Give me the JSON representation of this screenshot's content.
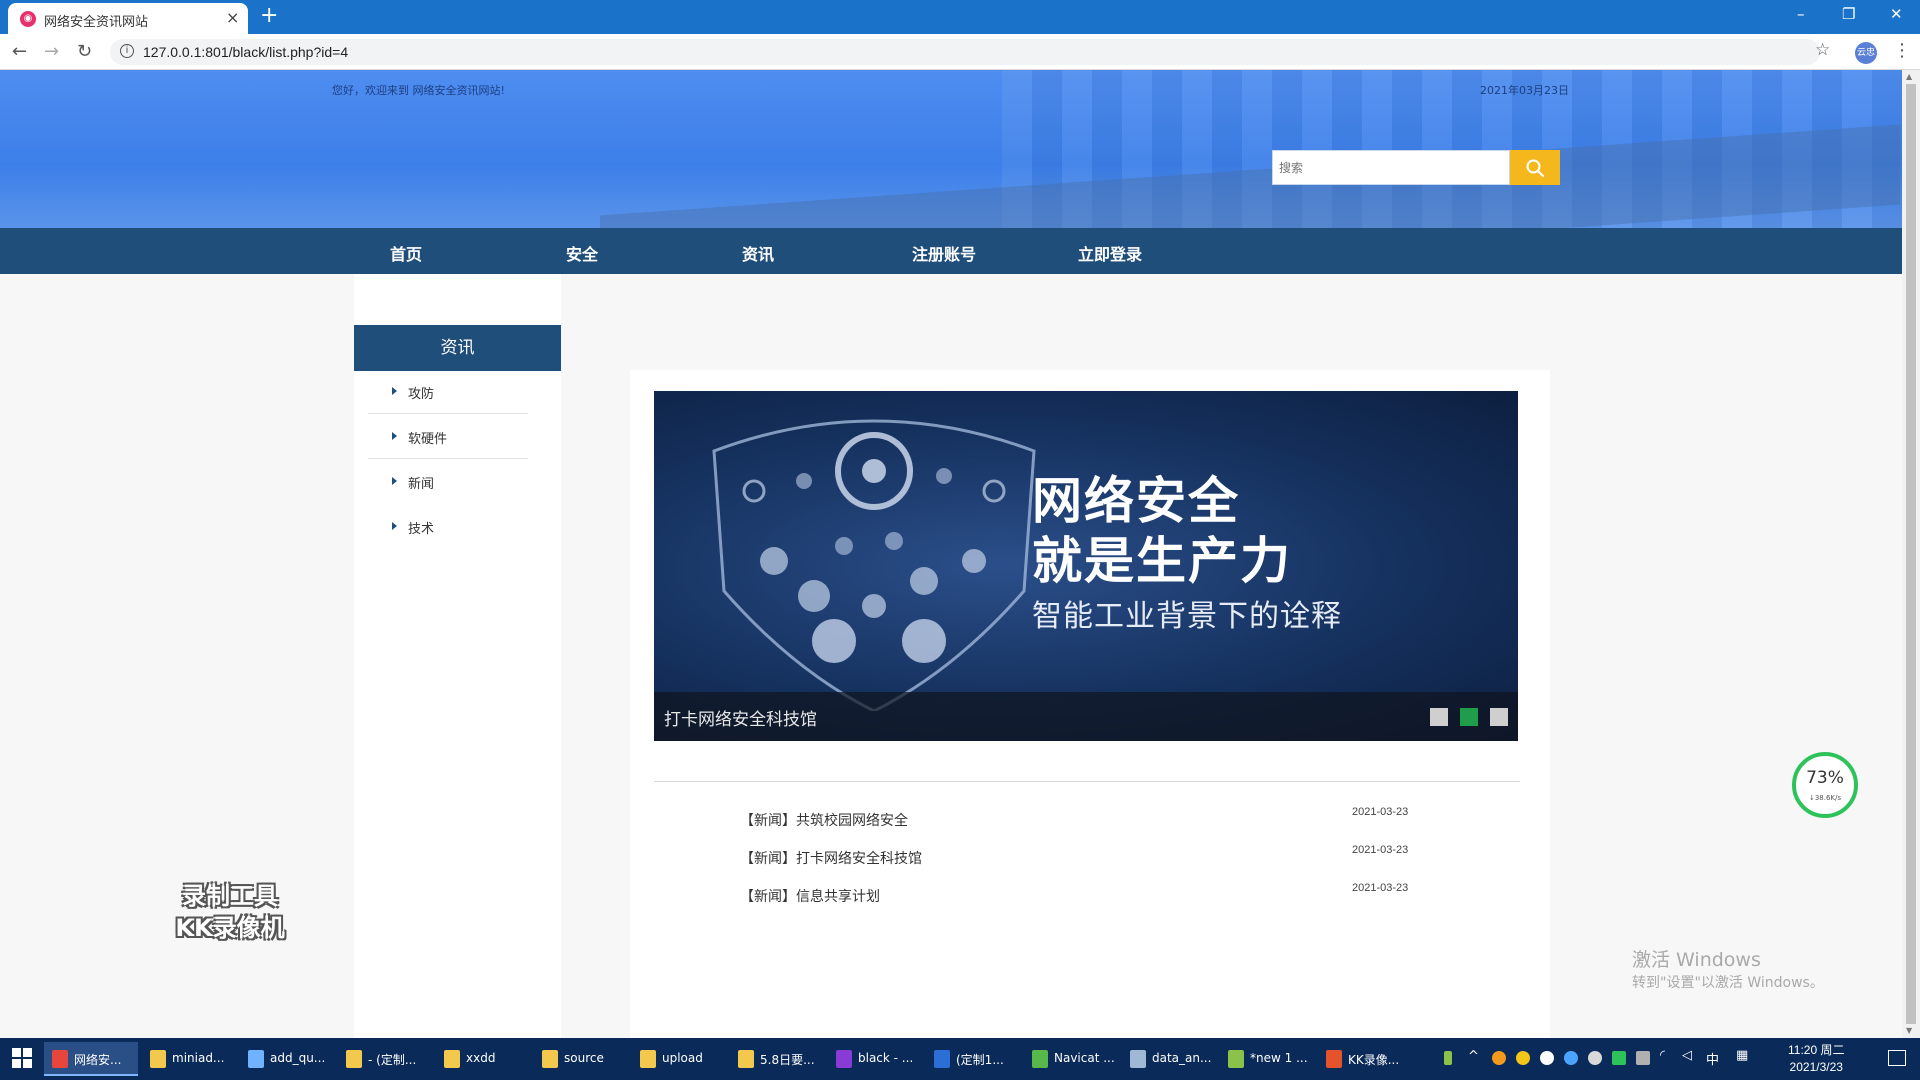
{
  "browser": {
    "tab_title": "网络安全资讯网站",
    "url": "127.0.0.1:801/black/list.php?id=4",
    "profile_label": "云忠",
    "window_controls": [
      "–",
      "❐",
      "✕"
    ]
  },
  "header": {
    "welcome": "您好，欢迎来到 网络安全资讯网站!",
    "date": "2021年03月23日",
    "search_placeholder": "搜索"
  },
  "nav": {
    "items": [
      "首页",
      "安全",
      "资讯",
      "注册账号",
      "立即登录"
    ]
  },
  "sidebar": {
    "title": "资讯",
    "items": [
      "攻防",
      "软硬件",
      "新闻",
      "技术"
    ]
  },
  "banner": {
    "headline_line1": "网络安全",
    "headline_line2": "就是生产力",
    "subtitle": "智能工业背景下的诠释",
    "caption": "打卡网络安全科技馆",
    "dots": [
      "#cfcfcf",
      "#1f9d4a",
      "#cfcfcf"
    ]
  },
  "news": [
    {
      "title": "【新闻】共筑校园网络安全",
      "date": "2021-03-23"
    },
    {
      "title": "【新闻】打卡网络安全科技馆",
      "date": "2021-03-23"
    },
    {
      "title": "【新闻】信息共享计划",
      "date": "2021-03-23"
    }
  ],
  "overlays": {
    "watermark_line1": "录制工具",
    "watermark_line2": "KK录像机",
    "speed_percent": "73%",
    "speed_rate": "↓38.6K/s",
    "activate_title": "激活 Windows",
    "activate_hint": "转到\"设置\"以激活 Windows。"
  },
  "taskbar": {
    "items": [
      {
        "label": "网络安...",
        "icon_color": "#e8453c"
      },
      {
        "label": "miniad...",
        "icon_color": "#f2c94c"
      },
      {
        "label": "add_qu...",
        "icon_color": "#6fb3ff"
      },
      {
        "label": "- (定制...",
        "icon_color": "#f2c94c"
      },
      {
        "label": "xxdd",
        "icon_color": "#f2c94c"
      },
      {
        "label": "source",
        "icon_color": "#f2c94c"
      },
      {
        "label": "upload",
        "icon_color": "#f2c94c"
      },
      {
        "label": "5.8日要...",
        "icon_color": "#f2c94c"
      },
      {
        "label": "black - ...",
        "icon_color": "#8a3ad6"
      },
      {
        "label": "(定制1...",
        "icon_color": "#2b6fd6"
      },
      {
        "label": "Navicat ...",
        "icon_color": "#56b94a"
      },
      {
        "label": "data_an...",
        "icon_color": "#9fb8d6"
      },
      {
        "label": "*new 1 ...",
        "icon_color": "#8bc34a"
      },
      {
        "label": "KK录像...",
        "icon_color": "#e5532d"
      }
    ],
    "ime_label": "中",
    "time": "11:20 周二",
    "date": "2021/3/23"
  }
}
